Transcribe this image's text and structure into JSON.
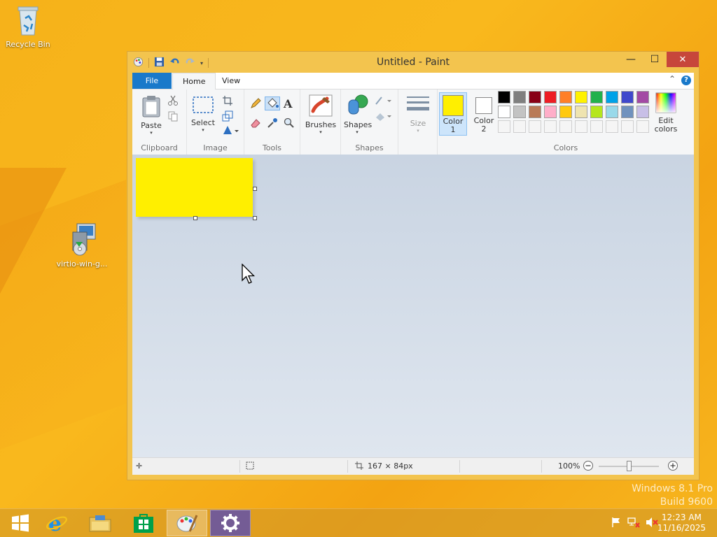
{
  "desktop": {
    "icons": [
      {
        "label": "Recycle Bin",
        "icon": "recycle-bin-icon"
      },
      {
        "label": "virtio-win-g...",
        "icon": "installer-icon"
      }
    ],
    "watermark": {
      "line1": "Windows 8.1 Pro",
      "line2": "Build 9600"
    }
  },
  "window": {
    "title": "Untitled - Paint",
    "controls": {
      "minimize": "—",
      "maximize": "☐",
      "close": "✕"
    }
  },
  "tabs": {
    "file": "File",
    "home": "Home",
    "view": "View"
  },
  "ribbon": {
    "clipboard": {
      "label": "Clipboard",
      "paste": "Paste"
    },
    "image": {
      "label": "Image",
      "select": "Select"
    },
    "tools": {
      "label": "Tools"
    },
    "brushes": {
      "label": "Brushes"
    },
    "shapes": {
      "label": "Shapes",
      "shapes_btn": "Shapes"
    },
    "size": {
      "label": "Size"
    },
    "colors": {
      "label": "Colors",
      "color1": "Color 1",
      "color2": "Color 2",
      "edit": "Edit colors",
      "color1_value": "#ffef00",
      "color2_value": "#ffffff",
      "row1": [
        "#000000",
        "#7f7f7f",
        "#880015",
        "#ed1c24",
        "#ff7f27",
        "#fff200",
        "#22b14c",
        "#00a2e8",
        "#3f48cc",
        "#a349a4"
      ],
      "row2": [
        "#ffffff",
        "#c3c3c3",
        "#b97a57",
        "#ffaec9",
        "#ffc90e",
        "#efe4b0",
        "#b5e61d",
        "#99d9ea",
        "#7092be",
        "#c8bfe7"
      ],
      "row3": [
        "#f5f5f5",
        "#f5f5f5",
        "#f5f5f5",
        "#f5f5f5",
        "#f5f5f5",
        "#f5f5f5",
        "#f5f5f5",
        "#f5f5f5",
        "#f5f5f5",
        "#f5f5f5"
      ]
    }
  },
  "canvas": {
    "fill": "#ffef00"
  },
  "status": {
    "size": "167 × 84px",
    "zoom": "100%"
  },
  "taskbar": {
    "items": [
      "start-icon",
      "internet-explorer-icon",
      "file-explorer-icon",
      "store-icon",
      "paint-icon",
      "settings-icon"
    ],
    "time": "12:23 AM",
    "date": "11/16/2025"
  }
}
